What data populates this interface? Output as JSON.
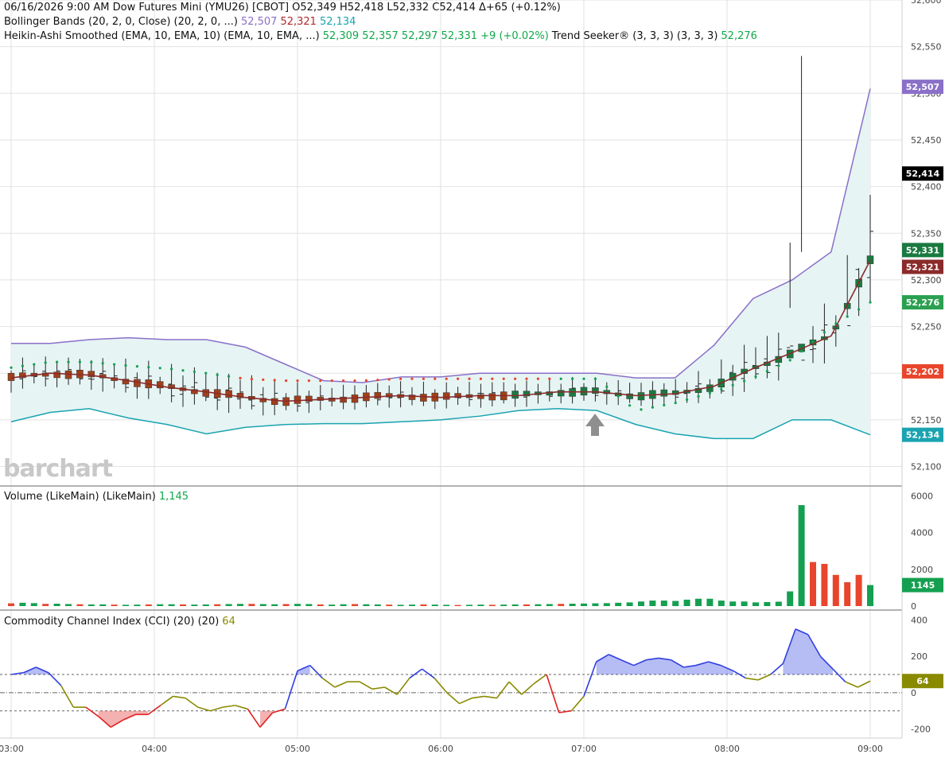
{
  "header": {
    "line1": "06/16/2026  9:00 AM  Dow Futures Mini (YMU26) [CBOT]  O52,349  H52,418  L52,332  C52,414  Δ+65 (+0.12%)",
    "bb_label": "Bollinger Bands (20, 2, 0, Close)  (20, 2, 0, ...)",
    "bb_upper": "52,507",
    "bb_mid": "52,321",
    "bb_lower": "52,134",
    "ha_label": "Heikin-Ashi Smoothed (EMA, 10, EMA, 10)  (EMA, 10, EMA, ...)",
    "ha_values": "52,309  52,357  52,297  52,331  +9 (+0.02%)",
    "ts_label": "Trend Seeker® (3, 3, 3)  (3, 3, 3)",
    "ts_value": "52,276"
  },
  "watermark": "barchart",
  "volume_panel": {
    "label": "Volume (LikeMain)  (LikeMain)",
    "value": "1,145",
    "badge": "1145"
  },
  "cci_panel": {
    "label": "Commodity Channel Index (CCI) (20)  (20)",
    "value": "64",
    "badge": "64"
  },
  "price_badges": {
    "upper": "52,507",
    "close": "52,414",
    "ha": "52,331",
    "mid": "52,321",
    "ts": "52,276",
    "stop": "52,202",
    "lower": "52,134"
  },
  "colors": {
    "up": "#14a050",
    "down": "#e8452c",
    "bb": "#8a70c8",
    "mid": "#8b2a2a",
    "lower": "#1aa3b0",
    "band_fill": "#e6f4f4",
    "cci_blue": "#2f3fe0",
    "cci_red": "#e02020",
    "cci_olive": "#8a8a00",
    "ha_up": "#1a7a40",
    "ha_down": "#a0401a"
  },
  "chart_data": [
    {
      "type": "line",
      "title": "Dow Futures Mini (YMU26) [CBOT]",
      "x": [
        "03:00",
        "04:00",
        "05:00",
        "06:00",
        "07:00",
        "08:00",
        "09:00"
      ],
      "ylim": [
        52080,
        52600
      ],
      "yticks": [
        "52,100",
        "52,150",
        "52,200",
        "52,250",
        "52,300",
        "52,350",
        "52,400",
        "52,450",
        "52,500",
        "52,550",
        "52,600"
      ],
      "series": [
        {
          "name": "Bollinger Upper",
          "values": [
            52232,
            52232,
            52236,
            52238,
            52236,
            52236,
            52228,
            52210,
            52192,
            52190,
            52196,
            52196,
            52200,
            52200,
            52200,
            52200,
            52195,
            52195,
            52230,
            52280,
            52300,
            52330,
            52505
          ]
        },
        {
          "name": "Bollinger Middle",
          "values": [
            52195,
            52200,
            52198,
            52192,
            52185,
            52180,
            52174,
            52170,
            52172,
            52174,
            52176,
            52174,
            52176,
            52176,
            52180,
            52180,
            52176,
            52178,
            52186,
            52205,
            52222,
            52240,
            52321
          ]
        },
        {
          "name": "Bollinger Lower",
          "values": [
            52148,
            52158,
            52162,
            52152,
            52145,
            52135,
            52142,
            52145,
            52146,
            52146,
            52148,
            52150,
            52154,
            52160,
            52162,
            52160,
            52145,
            52135,
            52130,
            52130,
            52150,
            52150,
            52134
          ]
        },
        {
          "name": "Trend Seeker",
          "values": [
            52206,
            52212,
            52212,
            52208,
            52205,
            52200,
            52194,
            52192,
            52192,
            52192,
            52194,
            52194,
            52194,
            52194,
            52194,
            52194,
            52160,
            52168,
            52180,
            52195,
            52215,
            52250,
            52276
          ]
        }
      ],
      "stop_badge": "52,202",
      "last": {
        "open": 52349,
        "high": 52418,
        "low": 52332,
        "close": 52414
      }
    },
    {
      "type": "bar",
      "title": "Volume (LikeMain)",
      "ylim": [
        0,
        6500
      ],
      "yticks": [
        "0",
        "2000",
        "4000",
        "6000"
      ],
      "values": [
        150,
        180,
        160,
        120,
        130,
        110,
        100,
        90,
        95,
        80,
        70,
        80,
        90,
        100,
        100,
        90,
        80,
        90,
        100,
        110,
        120,
        120,
        110,
        100,
        110,
        120,
        110,
        90,
        80,
        100,
        110,
        100,
        90,
        80,
        70,
        80,
        90,
        80,
        70,
        60,
        70,
        80,
        70,
        80,
        90,
        90,
        100,
        110,
        120,
        130,
        140,
        150,
        160,
        180,
        200,
        250,
        300,
        300,
        280,
        350,
        400,
        400,
        300,
        250,
        250,
        200,
        220,
        240,
        800,
        5500,
        2400,
        2300,
        1700,
        1300,
        1700,
        1145
      ],
      "last": 1145
    },
    {
      "type": "line",
      "title": "Commodity Channel Index (CCI) (20)",
      "ylim": [
        -250,
        450
      ],
      "yticks": [
        "400",
        "200",
        "0",
        "-200"
      ],
      "reference_lines": [
        100,
        0,
        -100
      ],
      "values": [
        100,
        110,
        140,
        110,
        40,
        -80,
        -80,
        -130,
        -190,
        -150,
        -120,
        -120,
        -70,
        -20,
        -30,
        -80,
        -100,
        -80,
        -70,
        -90,
        -190,
        -110,
        -90,
        120,
        150,
        80,
        30,
        60,
        60,
        20,
        30,
        -10,
        80,
        130,
        80,
        0,
        -60,
        -30,
        -20,
        -30,
        60,
        -10,
        50,
        100,
        -110,
        -100,
        -20,
        170,
        210,
        180,
        150,
        180,
        190,
        180,
        140,
        150,
        170,
        150,
        120,
        80,
        70,
        100,
        160,
        350,
        320,
        200,
        130,
        60,
        30,
        64
      ],
      "last": 64
    }
  ]
}
